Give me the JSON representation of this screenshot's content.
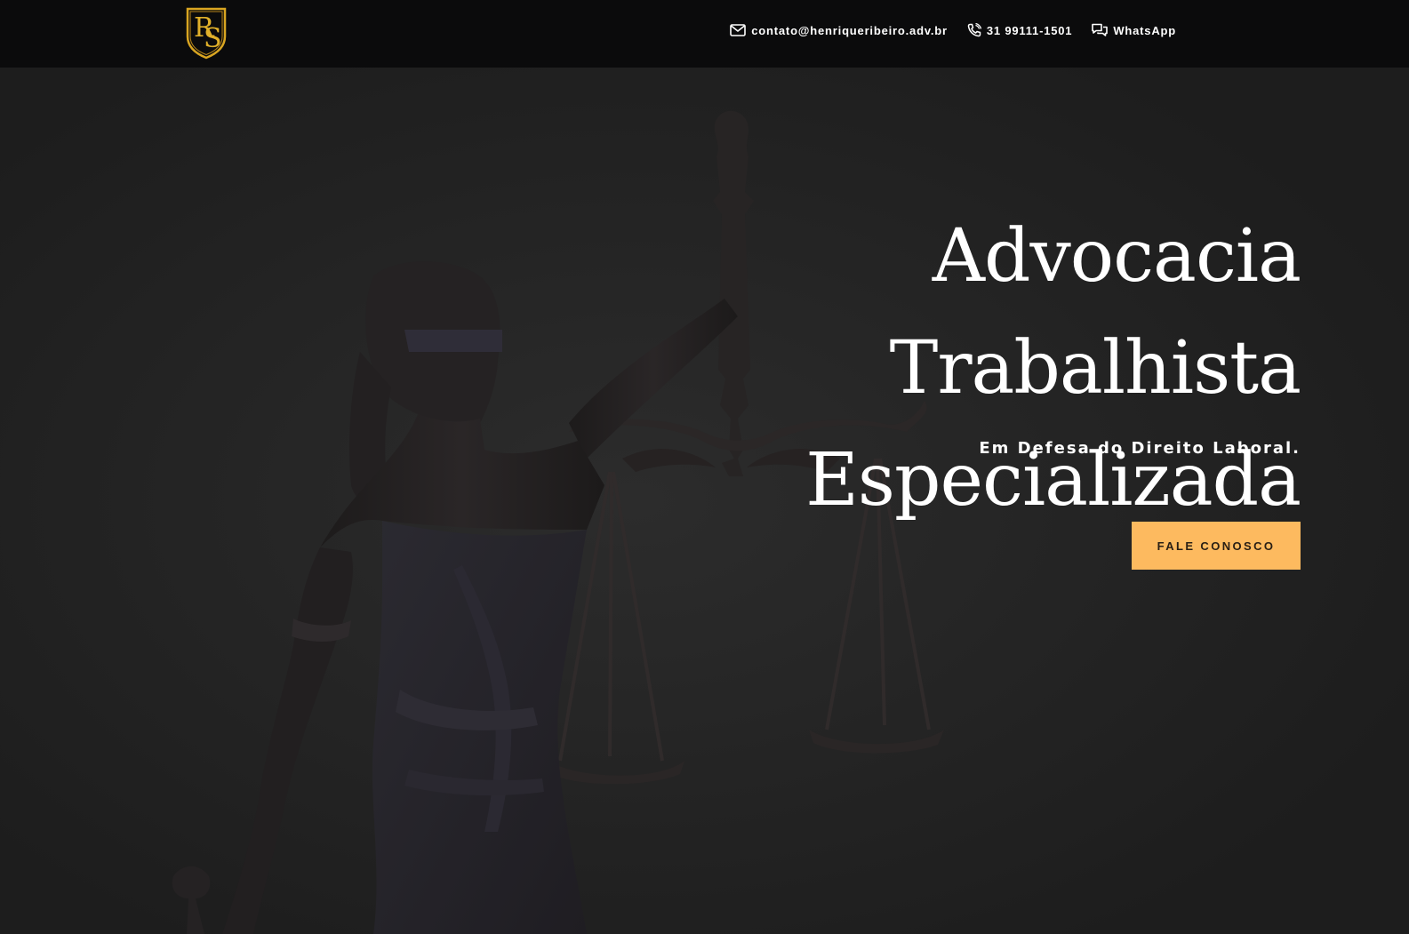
{
  "header": {
    "logo_letters": "RS",
    "contacts": [
      {
        "icon": "mail-icon",
        "label": "contato@henriqueribeiro.adv.br"
      },
      {
        "icon": "phone-icon",
        "label": "31 99111-1501"
      },
      {
        "icon": "chat-icon",
        "label": "WhatsApp"
      }
    ]
  },
  "hero": {
    "title_line1": "Advocacia Trabalhista",
    "title_line2": "Especializada",
    "subtitle": "Em Defesa do Direito Laboral.",
    "cta_label": "FALE CONOSCO"
  },
  "colors": {
    "topbar": "#0b0b0c",
    "background": "#1e1e1e",
    "accent": "#fdba5f",
    "logo_gold": "#d9a521",
    "text": "#ffffff"
  }
}
